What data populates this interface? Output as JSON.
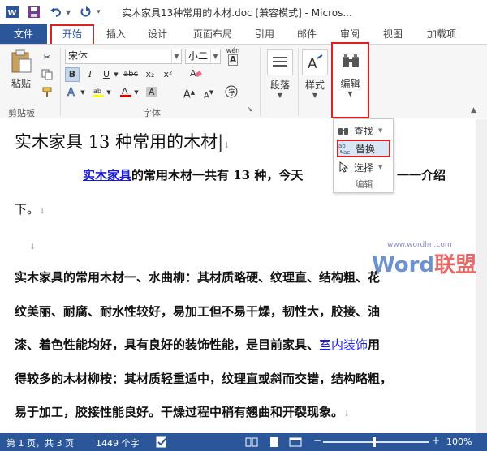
{
  "window": {
    "title": "实木家具13种常用的木材.doc [兼容模式] - Micros..."
  },
  "quick_access": {
    "icons": [
      "word-logo-icon",
      "save-icon",
      "undo-icon",
      "redo-icon"
    ]
  },
  "tabs": [
    {
      "label": "文件"
    },
    {
      "label": "开始"
    },
    {
      "label": "插入"
    },
    {
      "label": "设计"
    },
    {
      "label": "页面布局"
    },
    {
      "label": "引用"
    },
    {
      "label": "邮件"
    },
    {
      "label": "审阅"
    },
    {
      "label": "视图"
    },
    {
      "label": "加载项"
    }
  ],
  "ribbon": {
    "clipboard": {
      "paste_label": "粘贴",
      "group_label": "剪贴板"
    },
    "font": {
      "font_name": "宋体",
      "font_size": "小二",
      "phonetic_label": "wén",
      "bold": "B",
      "italic": "I",
      "underline": "U",
      "strike": "abc",
      "subscript": "x₂",
      "superscript": "x²",
      "grow": "A",
      "shrink": "A",
      "group_label": "字体"
    },
    "paragraph": {
      "label": "段落"
    },
    "styles": {
      "label": "样式"
    },
    "editing": {
      "label": "编辑"
    }
  },
  "dropdown": {
    "find": "查找",
    "replace": "替换",
    "select": "选择",
    "group_label": "编辑"
  },
  "document": {
    "heading": "实木家具 13 种常用的木材",
    "p1_link": "实木家具",
    "p1_rest": "的常用木材一共有 13 种，今天",
    "p1_tail": "一一介绍",
    "p1_line2": "下。",
    "body_l1": "实木家具的常用木材一、水曲柳：其材质略硬、纹理直、结构粗、花",
    "body_l2": "纹美丽、耐腐、耐水性较好，易加工但不易干燥，韧性大，胶接、油",
    "body_l3_a": "漆、着色性能均好，具有良好的装饰性能，是目前家具、",
    "body_l3_link": "室内装饰",
    "body_l3_b": "用",
    "body_l4": "得较多的木材柳桉：其材质轻重适中，纹理直或斜而交错，结构略粗，",
    "body_l5": "易于加工，胶接性能良好。干燥过程中稍有翘曲和开裂现象。",
    "watermark_url": "www.wordlm.com",
    "watermark_word": "Word",
    "watermark_cn": "联盟"
  },
  "status": {
    "page": "第 1 页，共 3 页",
    "words": "1449 个字",
    "zoom": "100%"
  },
  "colors": {
    "accent": "#2b579a",
    "highlight_red": "#e02020",
    "link": "#1a1adf"
  }
}
